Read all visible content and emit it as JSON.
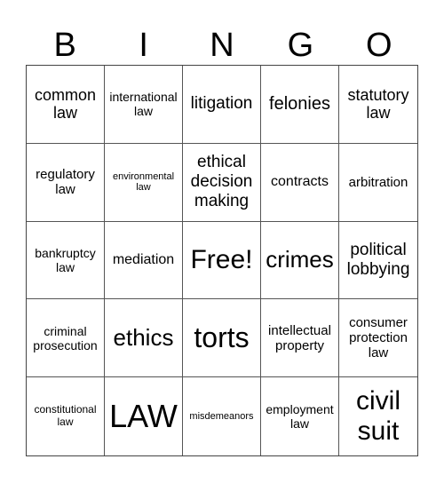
{
  "header": [
    "B",
    "I",
    "N",
    "G",
    "O"
  ],
  "cells": [
    "common law",
    "international law",
    "litigation",
    "felonies",
    "statutory law",
    "regulatory law",
    "environmental law",
    "ethical decision making",
    "contracts",
    "arbitration",
    "bankruptcy law",
    "mediation",
    "Free!",
    "crimes",
    "political lobbying",
    "criminal prosecution",
    "ethics",
    "torts",
    "intellectual property",
    "consumer protection law",
    "constitutional law",
    "LAW",
    "misdemeanors",
    "employment law",
    "civil suit"
  ]
}
